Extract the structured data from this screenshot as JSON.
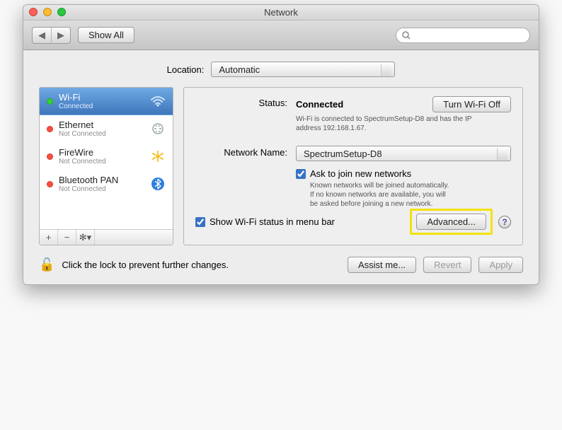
{
  "window": {
    "title": "Network"
  },
  "toolbar": {
    "show_all": "Show All"
  },
  "location": {
    "label": "Location:",
    "value": "Automatic"
  },
  "sidebar": {
    "items": [
      {
        "name": "Wi-Fi",
        "sub": "Connected",
        "dot": "green",
        "icon": "wifi"
      },
      {
        "name": "Ethernet",
        "sub": "Not Connected",
        "dot": "red",
        "icon": "eth"
      },
      {
        "name": "FireWire",
        "sub": "Not Connected",
        "dot": "red",
        "icon": "fw"
      },
      {
        "name": "Bluetooth PAN",
        "sub": "Not Connected",
        "dot": "red",
        "icon": "bt"
      }
    ]
  },
  "status": {
    "label": "Status:",
    "value": "Connected",
    "desc": "Wi-Fi is connected to SpectrumSetup-D8 and has the IP address 192.168.1.67.",
    "toggle_label": "Turn Wi-Fi Off"
  },
  "network_name": {
    "label": "Network Name:",
    "value": "SpectrumSetup-D8"
  },
  "ask_join": {
    "label": "Ask to join new networks",
    "desc1": "Known networks will be joined automatically.",
    "desc2": "If no known networks are available, you will",
    "desc3": "be asked before joining a new network."
  },
  "menubar_chk": {
    "label": "Show Wi-Fi status in menu bar"
  },
  "advanced": {
    "label": "Advanced..."
  },
  "lock": {
    "text": "Click the lock to prevent further changes."
  },
  "buttons": {
    "assist": "Assist me...",
    "revert": "Revert",
    "apply": "Apply"
  }
}
